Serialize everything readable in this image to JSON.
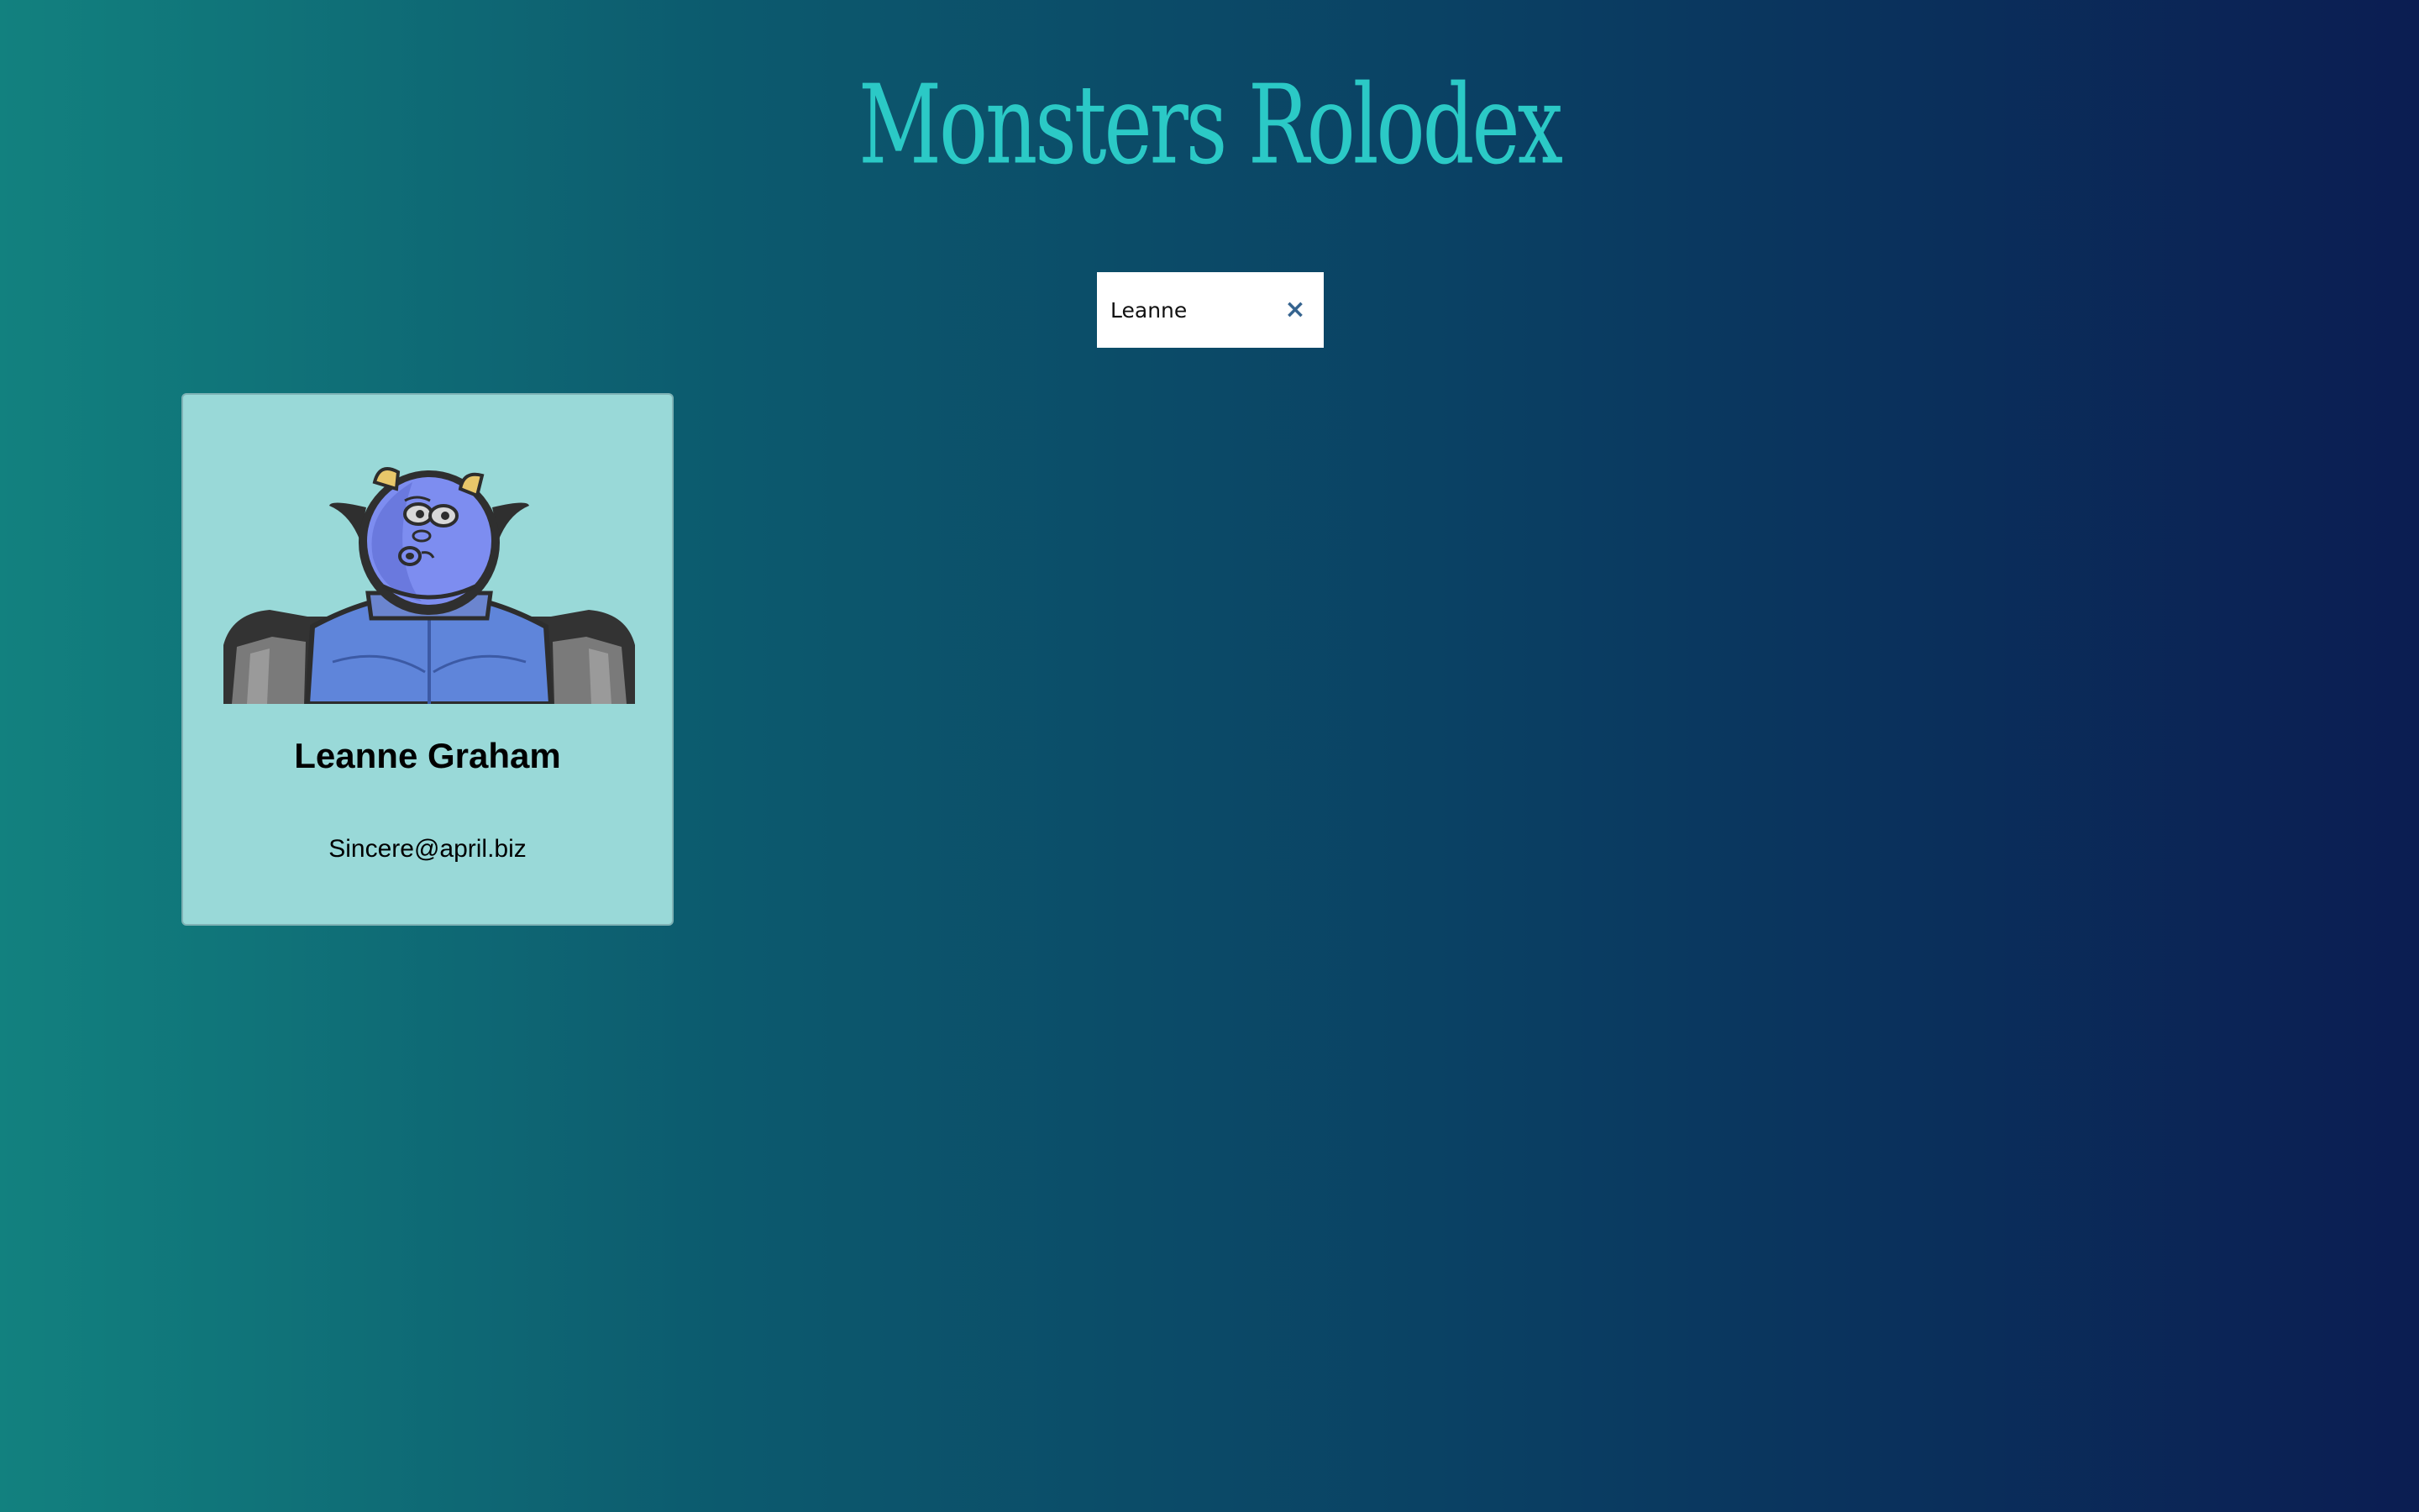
{
  "header": {
    "title": "Monsters Rolodex"
  },
  "search": {
    "value": "Leanne",
    "clear_icon": "close-icon",
    "clear_glyph": "×"
  },
  "monsters": [
    {
      "name": "Leanne Graham",
      "email": "Sincere@april.biz",
      "avatar_icon": "monster-avatar"
    }
  ],
  "colors": {
    "title": "#2bc9c6",
    "card_background": "#99d9d8",
    "gradient_start": "#12817f",
    "gradient_end": "#0b1d52",
    "clear_icon": "#36648f"
  }
}
